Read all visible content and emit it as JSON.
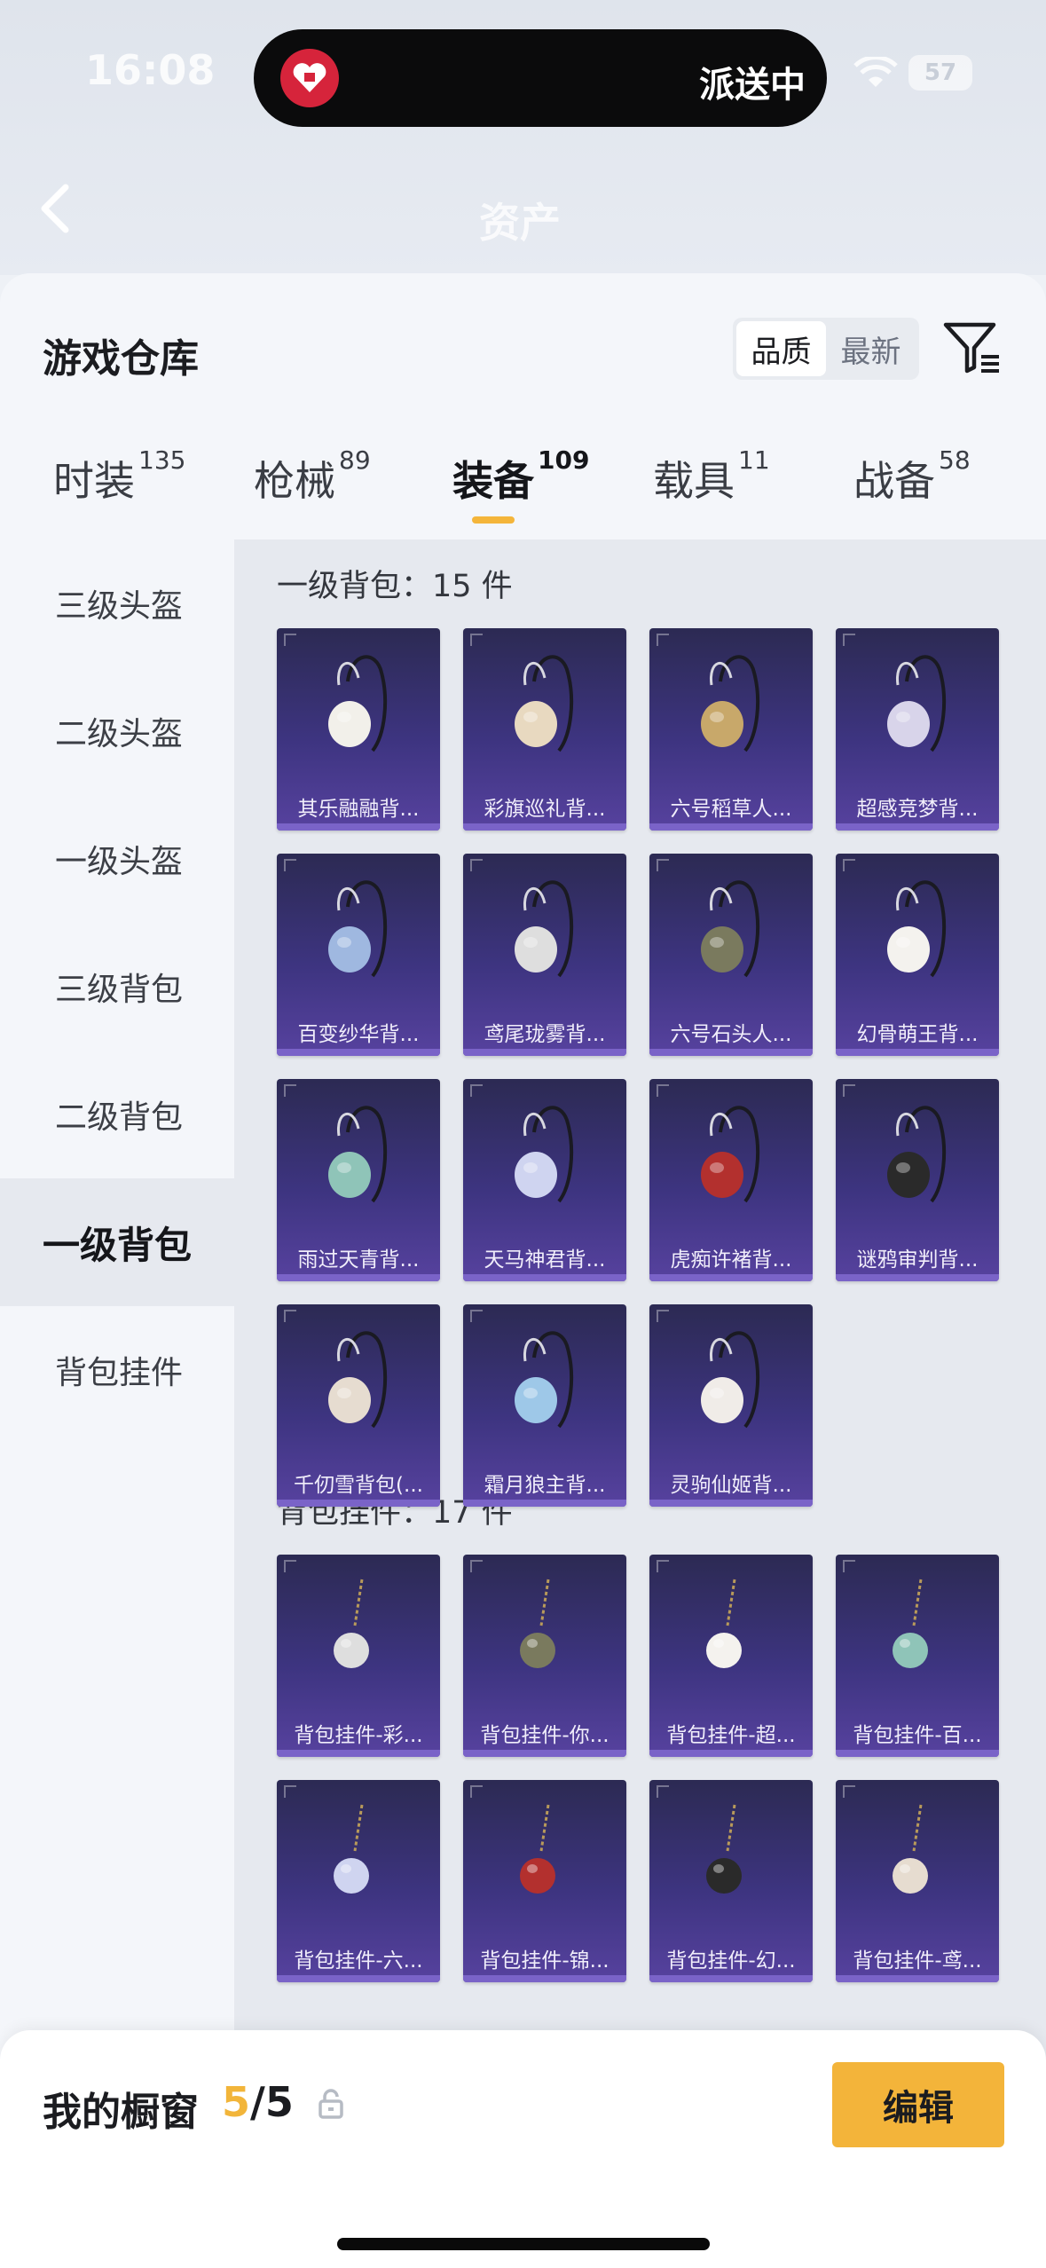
{
  "status_bar": {
    "time": "16:08",
    "battery": "57"
  },
  "dynamic_island": {
    "text": "派送中"
  },
  "nav": {
    "title": "资产"
  },
  "sheet": {
    "title": "游戏仓库",
    "sort_options": [
      "品质",
      "最新"
    ],
    "active_sort": "品质"
  },
  "tabs": [
    {
      "label": "时装",
      "count": "135"
    },
    {
      "label": "枪械",
      "count": "89"
    },
    {
      "label": "装备",
      "count": "109"
    },
    {
      "label": "载具",
      "count": "11"
    },
    {
      "label": "战备",
      "count": "58"
    }
  ],
  "active_tab": "装备",
  "sidebar": {
    "items": [
      "三级头盔",
      "二级头盔",
      "一级头盔",
      "三级背包",
      "二级背包",
      "一级背包",
      "背包挂件"
    ],
    "active": "一级背包"
  },
  "sections": [
    {
      "title": "一级背包：15 件",
      "items": [
        "其乐融融背...",
        "彩旗巡礼背...",
        "六号稻草人...",
        "超感竞梦背...",
        "百变纱华背...",
        "鸢尾珑雾背...",
        "六号石头人...",
        "幻骨萌王背...",
        "雨过天青背...",
        "天马神君背...",
        "虎痴许褚背...",
        "谜鸦审判背...",
        "千仞雪背包(...",
        "霜月狼主背...",
        "灵驹仙姬背..."
      ]
    },
    {
      "title": "背包挂件：17 件",
      "items": [
        "背包挂件-彩...",
        "背包挂件-你...",
        "背包挂件-超...",
        "背包挂件-百...",
        "背包挂件-六...",
        "背包挂件-锦...",
        "背包挂件-幻...",
        "背包挂件-鸢..."
      ]
    }
  ],
  "bottom_bar": {
    "label": "我的橱窗",
    "current": "5",
    "total": "/5",
    "edit_label": "编辑"
  },
  "colors": {
    "accent": "#f3b43a",
    "card_top": "#2c2a53",
    "card_bottom": "#57429f"
  }
}
